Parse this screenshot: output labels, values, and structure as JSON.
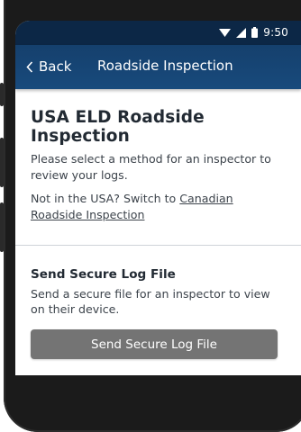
{
  "status_bar": {
    "time": "9:50",
    "icons": [
      "wifi-icon",
      "signal-icon",
      "battery-icon"
    ]
  },
  "app_bar": {
    "back_label": "Back",
    "title": "Roadside Inspection"
  },
  "main": {
    "title": "USA ELD Roadside Inspection",
    "intro": "Please select a method for an inspector to review your logs.",
    "switch_prefix": "Not in the USA? Switch to ",
    "switch_link": "Canadian Roadside Inspection"
  },
  "secure_log": {
    "heading": "Send Secure Log File",
    "description": "Send a secure file for an inspector to view on their device.",
    "button_label": "Send Secure Log File"
  },
  "colors": {
    "status_bar": "#0c2746",
    "app_bar": "#184a7c",
    "button": "#747474",
    "text": "#222a33"
  }
}
